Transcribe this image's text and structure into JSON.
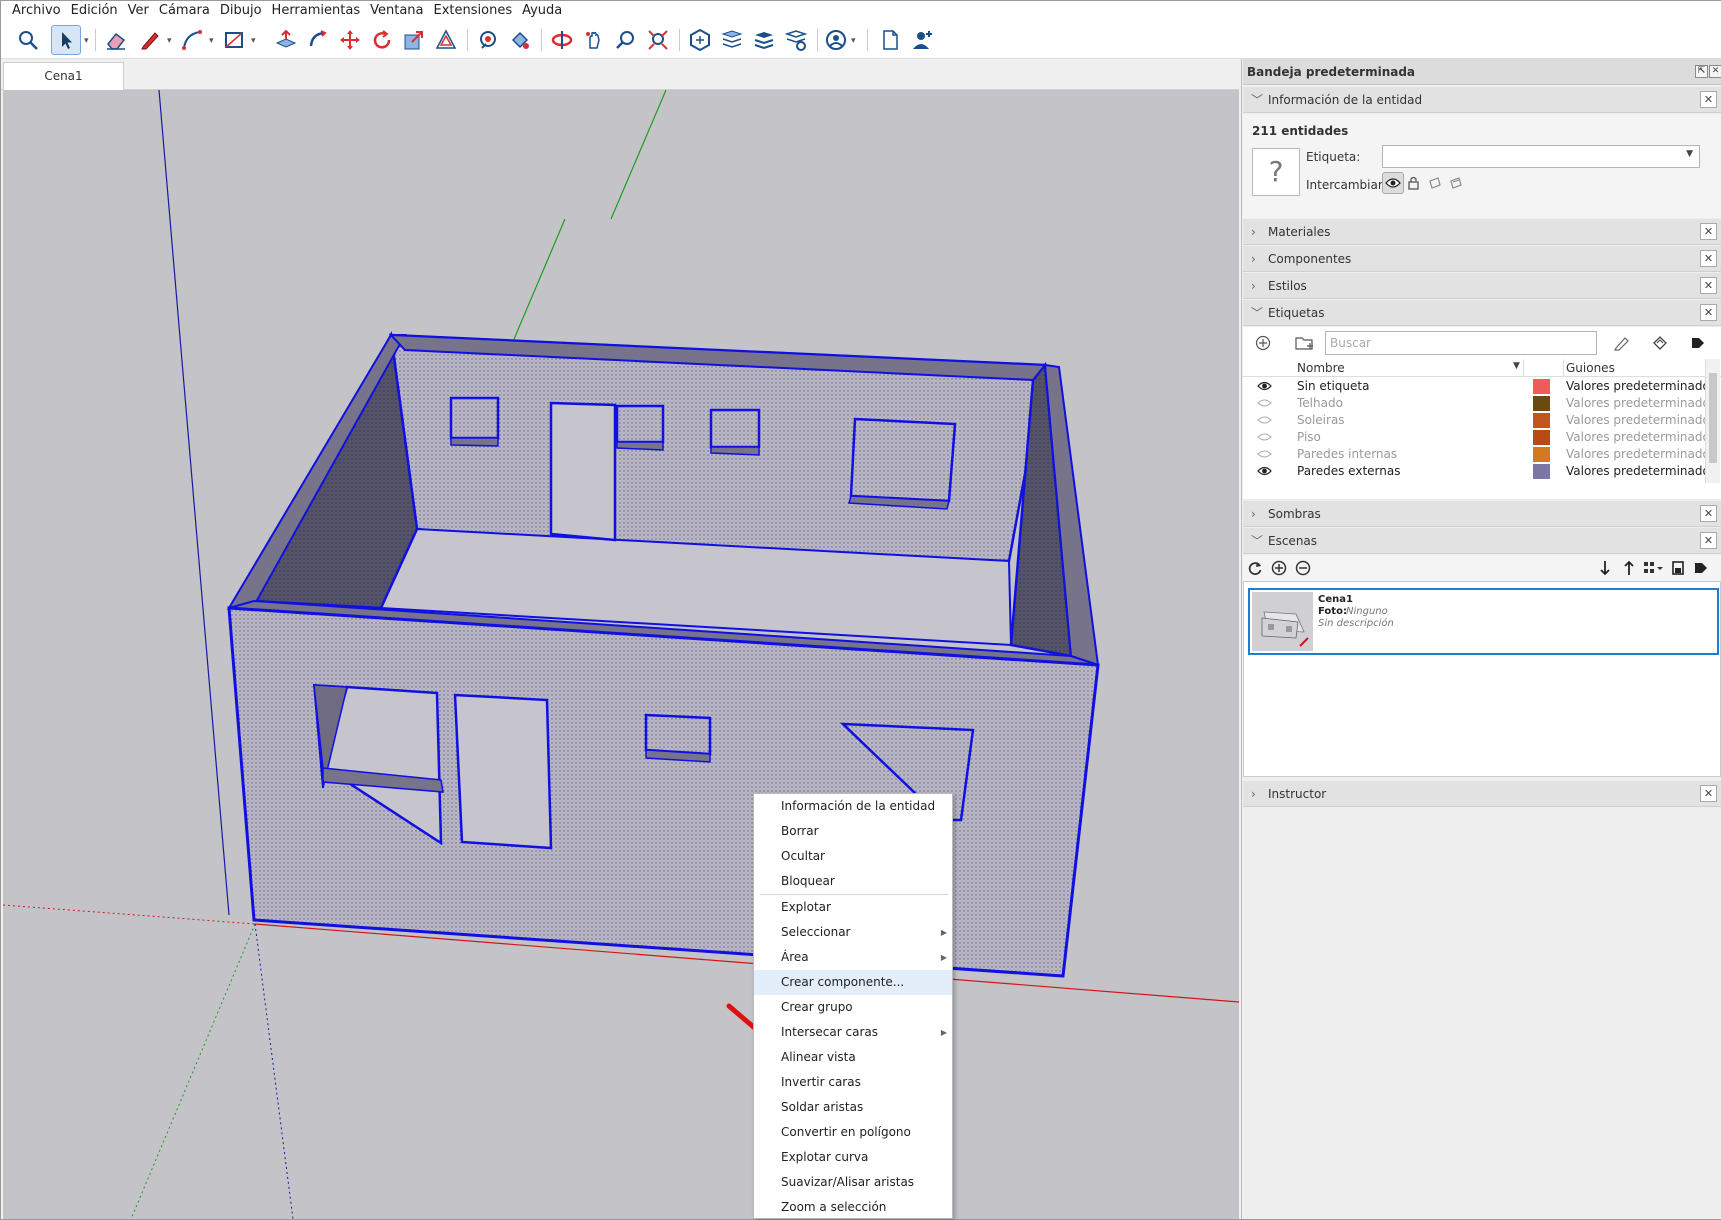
{
  "menu": [
    "Archivo",
    "Edición",
    "Ver",
    "Cámara",
    "Dibujo",
    "Herramientas",
    "Ventana",
    "Extensiones",
    "Ayuda"
  ],
  "tabs": {
    "scene_tab": "Cena1"
  },
  "tray": {
    "title": "Bandeja predeterminada",
    "entity_info": {
      "header": "Información de la entidad",
      "count": "211 entidades",
      "tag_label": "Etiqueta:",
      "tag_value": "",
      "toggle_label": "Intercambiar:"
    },
    "panels": {
      "materials": "Materiales",
      "components": "Componentes",
      "styles": "Estilos",
      "tags": "Etiquetas",
      "shadows": "Sombras",
      "scenes": "Escenas",
      "instructor": "Instructor"
    },
    "tags": {
      "search_placeholder": "Buscar",
      "col_name": "Nombre",
      "col_dashes": "Guiones",
      "rows": [
        {
          "name": "Sin etiqueta",
          "visible": true,
          "color": "#f05a5a",
          "dashes": "Valores predeterminados"
        },
        {
          "name": "Telhado",
          "visible": false,
          "color": "#6b4a12",
          "dashes": "Valores predeterminados"
        },
        {
          "name": "Soleiras",
          "visible": false,
          "color": "#c4551a",
          "dashes": "Valores predeterminados"
        },
        {
          "name": "Piso",
          "visible": false,
          "color": "#b84a14",
          "dashes": "Valores predeterminados"
        },
        {
          "name": "Paredes internas",
          "visible": false,
          "color": "#d6781e",
          "dashes": "Valores predeterminados"
        },
        {
          "name": "Paredes externas",
          "visible": true,
          "color": "#7b76a6",
          "dashes": "Valores predeterminados"
        }
      ]
    },
    "scene": {
      "name": "Cena1",
      "photo_label": "Foto:",
      "photo_value": "Ninguno",
      "description": "Sin descripción"
    }
  },
  "context_menu": {
    "items": [
      "Información de la entidad",
      "Borrar",
      "Ocultar",
      "Bloquear",
      "Explotar",
      "Seleccionar",
      "Área",
      "Crear componente...",
      "Crear grupo",
      "Intersecar caras",
      "Alinear vista",
      "Invertir caras",
      "Soldar aristas",
      "Convertir en polígono",
      "Explotar curva",
      "Suavizar/Alisar aristas",
      "Zoom a selección"
    ],
    "highlighted": "Crear componente..."
  },
  "colors": {
    "selection_blue": "#1010e0",
    "viewport_bg": "#c3c3c8",
    "wall_face": "#b9b6c6",
    "annotation_red": "#e01010"
  }
}
